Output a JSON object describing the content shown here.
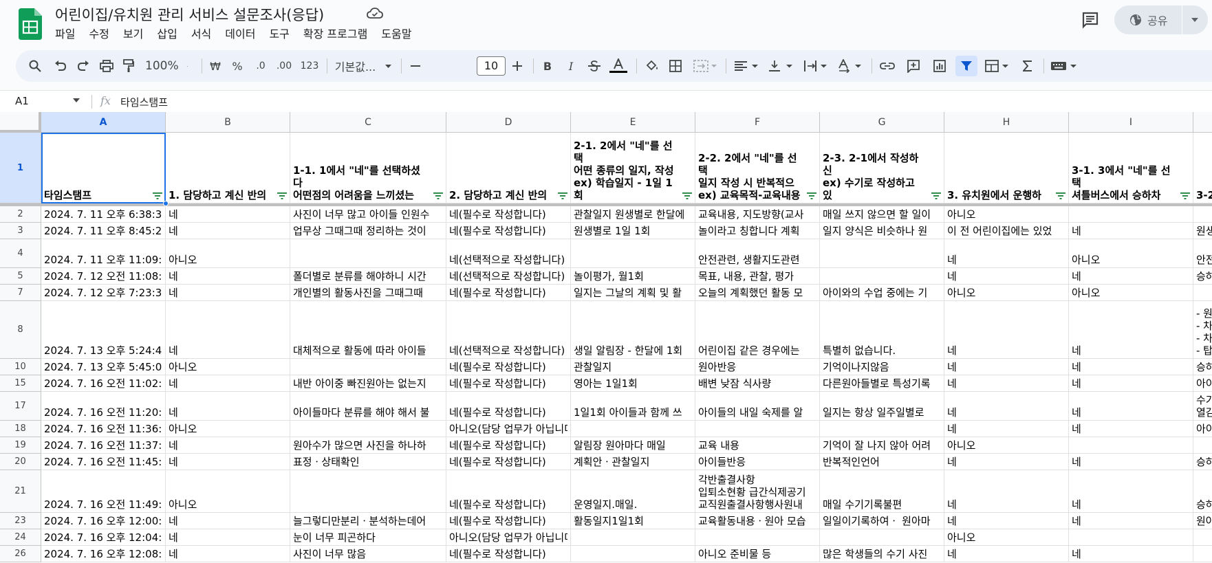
{
  "document": {
    "title": "어린이집/유치원 관리 서비스 설문조사(응답)",
    "menu": [
      "파일",
      "수정",
      "보기",
      "삽입",
      "서식",
      "데이터",
      "도구",
      "확장 프로그램",
      "도움말"
    ],
    "share_label": "공유"
  },
  "toolbar": {
    "zoom": "100%",
    "currency": "₩",
    "percent": "%",
    "decimal_decrease": ".0",
    "decimal_increase": ".00",
    "number_format": "123",
    "font_name": "기본값...",
    "font_size": "10",
    "bold": "B",
    "italic": "I"
  },
  "formula_bar": {
    "name_box": "A1",
    "fx": "fx",
    "content": "타임스탬프"
  },
  "grid": {
    "columns": [
      "A",
      "B",
      "C",
      "D",
      "E",
      "F",
      "G",
      "H",
      "I"
    ],
    "header_row": {
      "row_number": "1",
      "cells": [
        "타임스탬프",
        "1. 담당하고 계신 반의",
        "1-1. 1에서 \"네\"를 선택하셨다\n어떤점의 어려움을 느끼셨는",
        "2. 담당하고 계신 반의",
        "2-1. 2에서 \"네\"를 선택\n어떤 종류의 일지, 작성\nex) 학습일지 - 1일 1회",
        "2-2. 2에서 \"네\"를 선택\n일지 작성 시 반복적으\nex) 교육목적-교육내용",
        "2-3. 2-1에서 작성하신\nex) 수기로 작성하고 있",
        "3.  유치원에서 운행하",
        "3-1. 3에서 \"네\"를 선택\n셔틀버스에서 승하차",
        "3-2"
      ]
    },
    "rows": [
      {
        "num": "2",
        "cells": [
          "2024. 7. 11 오후 6:38:34",
          "네",
          "사진이 너무 많고 아이들 인원수",
          "네(필수로 작성합니다)",
          "관찰일지 원생별로 한달에",
          "교육내용, 지도방향(교사",
          "매일 쓰지 않으면 할 일이",
          "아니오",
          "",
          ""
        ]
      },
      {
        "num": "3",
        "cells": [
          "2024. 7. 11 오후 8:45:20",
          "네",
          "업무상 그때그때 정리하는 것이",
          "네(필수로 작성합니다)",
          "원생별로 1일 1회",
          "놀이라고 칭합니다 계획",
          "일지 양식은 비슷하나 원",
          "이 전 어린이집에는 있었",
          "네",
          "원생"
        ]
      },
      {
        "num": "4",
        "cells": [
          "2024. 7. 11 오후 11:09:10",
          "아니오",
          "",
          "네(선택적으로 작성합니다)",
          "",
          "안전관련, 생활지도관련",
          "",
          "네",
          "아니오",
          "안전"
        ]
      },
      {
        "num": "5",
        "cells": [
          "2024. 7. 12 오전 11:08:40",
          "네",
          "폴더별로 분류를 해야하니 시간",
          "네(선택적으로 작성합니다)",
          "놀이평가, 월1회",
          "목표, 내용, 관찰, 평가",
          "",
          "네",
          "네",
          "승하"
        ]
      },
      {
        "num": "7",
        "cells": [
          "2024. 7. 12 오후 7:23:35",
          "네",
          "개인별의 활동사진을 그때그때",
          "네(필수로 작성합니다)",
          "일지는 그날의 계획 및 활",
          "오늘의 계획했던 활동 모",
          "아이와의 수업 중에는 기",
          "아니오",
          "아니오",
          ""
        ]
      },
      {
        "num": "8",
        "cells": [
          "2024. 7. 13 오후 5:24:49",
          "네",
          "대체적으로 활동에 따라 아이들",
          "네(선택적으로 작성합니다)",
          "생일 알림장 - 한달에 1회",
          "어린이집 같은 경우에는",
          "특별히 없습니다.",
          "네",
          "네",
          "- 원\n- 차\n- 차\n- 탑"
        ]
      },
      {
        "num": "10",
        "cells": [
          "2024. 7. 13 오후 5:45:07",
          "아니오",
          "",
          "네(필수로 작성합니다)",
          "관찰일지",
          "원아반응",
          "기억이나지않음",
          "네",
          "네",
          "승하"
        ]
      },
      {
        "num": "15",
        "cells": [
          "2024. 7. 16 오전 11:02:17",
          "네",
          "내반 아이중 빠진원아는 없는지",
          "네(필수로 작성합니다)",
          "영아는 1일1회",
          "배변 낮잠 식사량",
          "다른원아들별로 특성기록",
          "네",
          "네",
          "아이"
        ]
      },
      {
        "num": "17",
        "cells": [
          "2024. 7. 16 오전 11:20:34",
          "네",
          "아이들마다 분류를 해야 해서 불",
          "네(필수로 작성합니다)",
          "1일1회 아이들과 함께 쓰",
          "아이들의 내일 숙제를 알",
          "일지는 항상 일주일별로",
          "네",
          "네",
          "수기\n열감"
        ]
      },
      {
        "num": "18",
        "cells": [
          "2024. 7. 16 오전 11:36:32",
          "아니오",
          "",
          "아니오(담당 업무가 아닙니다)",
          "",
          "",
          "",
          "네",
          "네",
          "아이"
        ]
      },
      {
        "num": "19",
        "cells": [
          "2024. 7. 16 오전 11:37:50",
          "네",
          "원아수가 많으면 사진을 하나하",
          "네(필수로 작성합니다)",
          "알림장 원아마다 매일",
          "교육 내용",
          "기억이 잘 나지 않아 어려",
          "아니오",
          "",
          ""
        ]
      },
      {
        "num": "20",
        "cells": [
          "2024. 7. 16 오전 11:45:29",
          "네",
          "표정ㆍ상태확인",
          "네(필수로 작성합니다)",
          "계획안ㆍ관찰일지",
          "아이들반응",
          "반복적인언어",
          "네",
          "네",
          "승하"
        ]
      },
      {
        "num": "21",
        "cells": [
          "2024. 7. 16 오전 11:49:39",
          "아니오",
          "",
          "네(필수로 작성합니다)",
          "운영일지.매일.",
          "각반출결사항\n입퇴소현황 급간식제공기\n교직원출결사항행사원내",
          "매일 수기기록불편",
          "네",
          "네",
          "승하"
        ]
      },
      {
        "num": "23",
        "cells": [
          "2024. 7. 16 오후 12:00:10",
          "네",
          "늘그렇디만분리ㆍ분석하는데어",
          "네(필수로 작성합니다)",
          "활동일지1일1회",
          "교육활동내용ㆍ원아 모습",
          "일일이기록하여ㆍ 원아마",
          "네",
          "네",
          "원아"
        ]
      },
      {
        "num": "24",
        "cells": [
          "2024. 7. 16 오후 12:04:48",
          "네",
          "눈이 너무 피곤하다",
          "아니오(담당 업무가 아닙니다)",
          "",
          "",
          "",
          "아니오",
          "",
          ""
        ]
      },
      {
        "num": "26",
        "cells": [
          "2024. 7. 16 오후 12:08:10",
          "네",
          "사진이 너무 많음",
          "네(필수로 작성합니다)",
          "",
          "아니오 준비물 등",
          "많은 학생들의 수기 사진",
          "네",
          "네",
          ""
        ]
      }
    ]
  }
}
